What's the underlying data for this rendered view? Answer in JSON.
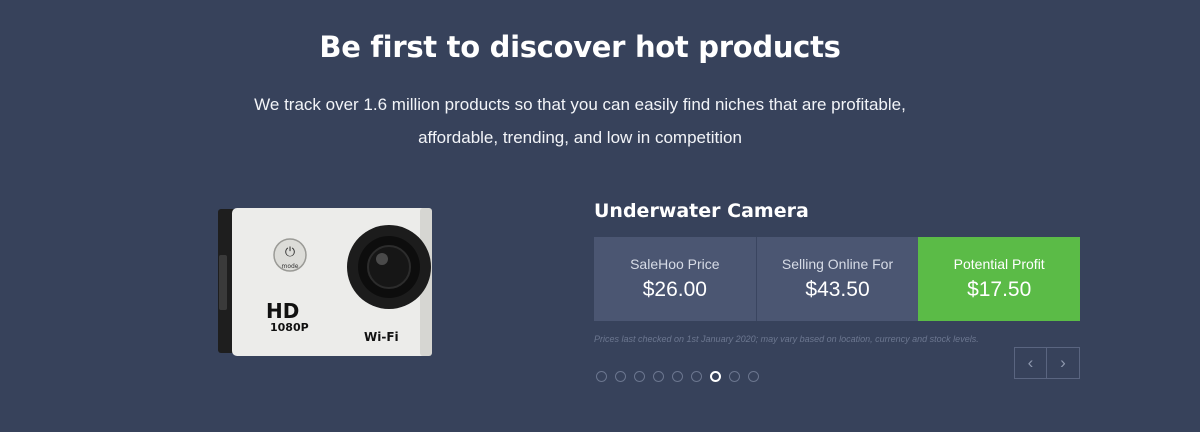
{
  "hero": {
    "headline": "Be first to discover hot products",
    "subtext_line1": "We track over 1.6 million products so that you can easily find niches that are profitable,",
    "subtext_line2": "affordable, trending, and low in competition"
  },
  "product": {
    "name": "Underwater Camera",
    "image_labels": {
      "hd": "HD",
      "resolution": "1080P",
      "wifi": "Wi-Fi",
      "mode": "mode"
    },
    "prices": [
      {
        "label": "SaleHoo Price",
        "value": "$26.00"
      },
      {
        "label": "Selling Online For",
        "value": "$43.50"
      },
      {
        "label": "Potential Profit",
        "value": "$17.50"
      }
    ],
    "disclaimer": "Prices last checked on 1st January 2020; may vary based on location, currency and stock levels."
  },
  "carousel": {
    "prev_icon": "‹",
    "next_icon": "›",
    "total": 9,
    "active_index": 6
  },
  "colors": {
    "background": "#37425b",
    "price_cell": "#4b5672",
    "profit_cell": "#5bbb47"
  }
}
